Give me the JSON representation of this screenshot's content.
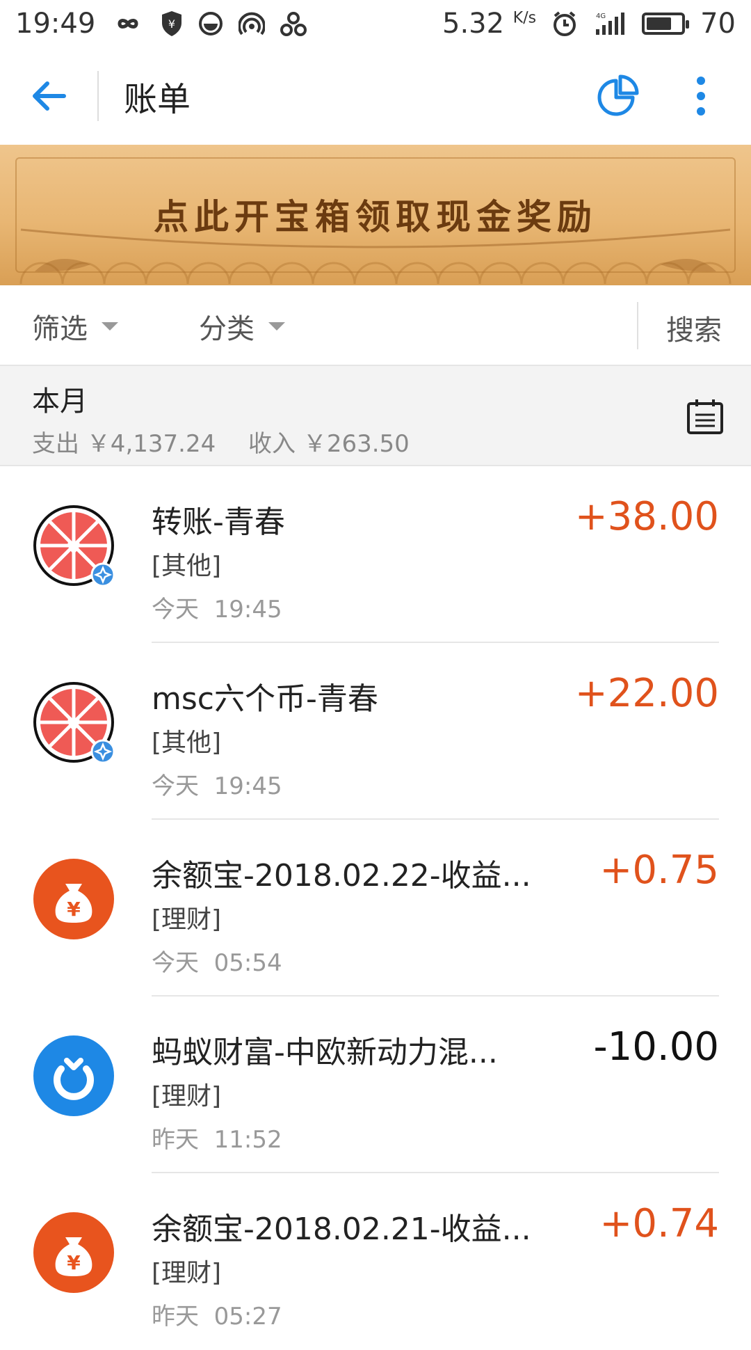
{
  "status_bar": {
    "time": "19:49",
    "net_speed": "5.32",
    "net_speed_unit": "K/s",
    "network": "4G",
    "battery": "70",
    "battery_level": 0.7,
    "icons": [
      "infinity-icon",
      "shield-yen-icon",
      "circle-app-icon",
      "hotspot-icon",
      "pinwheel-icon",
      "alarm-icon",
      "signal-icon",
      "battery-icon"
    ]
  },
  "header": {
    "title": "账单",
    "icons": [
      "back-arrow-icon",
      "pie-chart-icon",
      "more-vertical-icon"
    ],
    "accent_color": "#1e88e5"
  },
  "banner": {
    "text": "点此开宝箱领取现金奖励"
  },
  "filters": {
    "filter_label": "筛选",
    "category_label": "分类",
    "search_label": "搜索"
  },
  "month": {
    "label": "本月",
    "expense": "支出 ￥4,137.24",
    "income": "收入 ￥263.50"
  },
  "transactions": [
    {
      "title": "转账-青春",
      "category": "[其他]",
      "day": "今天",
      "time": "19:45",
      "amount": "+38.00",
      "icon": "grapefruit-avatar-icon"
    },
    {
      "title": "msc六个币-青春",
      "category": "[其他]",
      "day": "今天",
      "time": "19:45",
      "amount": "+22.00",
      "icon": "grapefruit-avatar-icon"
    },
    {
      "title": "余额宝-2018.02.22-收益...",
      "category": "[理财]",
      "day": "今天",
      "time": "05:54",
      "amount": "+0.75",
      "icon": "money-bag-icon"
    },
    {
      "title": "蚂蚁财富-中欧新动力混...",
      "category": "[理财]",
      "day": "昨天",
      "time": "11:52",
      "amount": "-10.00",
      "icon": "ant-fortune-icon"
    },
    {
      "title": "余额宝-2018.02.21-收益...",
      "category": "[理财]",
      "day": "昨天",
      "time": "05:27",
      "amount": "+0.74",
      "icon": "money-bag-icon"
    }
  ],
  "colors": {
    "income": "#e0521c",
    "expense": "#111111",
    "orange_icon": "#e8541e",
    "blue_icon": "#1e88e5"
  }
}
